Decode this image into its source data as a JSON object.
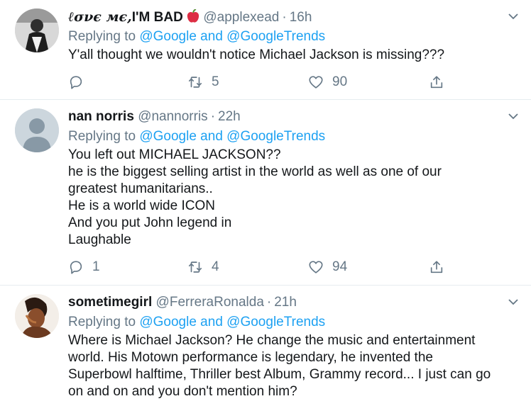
{
  "tweets": [
    {
      "name": "ℓσνє мє,",
      "name_bold": "I'M BAD",
      "emoji": "apple-icon",
      "handle": "@applexead",
      "time": "16h",
      "replying_prefix": "Replying to ",
      "mention1": "@Google",
      "and": " and ",
      "mention2": "@GoogleTrends",
      "lines": [
        "Y'all thought we wouldn't notice Michael Jackson is missing???"
      ],
      "replies": "",
      "retweets": "5",
      "likes": "90"
    },
    {
      "name": "nan norris",
      "handle": "@nannorris",
      "time": "22h",
      "replying_prefix": "Replying to ",
      "mention1": "@Google",
      "and": " and ",
      "mention2": "@GoogleTrends",
      "lines": [
        "You left out MICHAEL JACKSON??",
        "he is the biggest selling artist in the world as well as one of our",
        "greatest humanitarians..",
        "He is a world wide ICON",
        "And you put John legend in",
        "Laughable"
      ],
      "replies": "1",
      "retweets": "4",
      "likes": "94"
    },
    {
      "name": "sometimegirl",
      "handle": "@FerreraRonalda",
      "time": "21h",
      "replying_prefix": "Replying to ",
      "mention1": "@Google",
      "and": " and ",
      "mention2": "@GoogleTrends",
      "lines": [
        "Where is Michael Jackson? He change the music and entertainment",
        "world. His Motown performance is legendary, he invented the",
        "Superbowl halftime, Thriller best Album, Grammy record... I just can go",
        "on and on and you don't mention him?"
      ]
    }
  ],
  "colors": {
    "accent": "#1da1f2",
    "muted": "#657786",
    "text": "#14171a",
    "border": "#e6ecf0"
  }
}
